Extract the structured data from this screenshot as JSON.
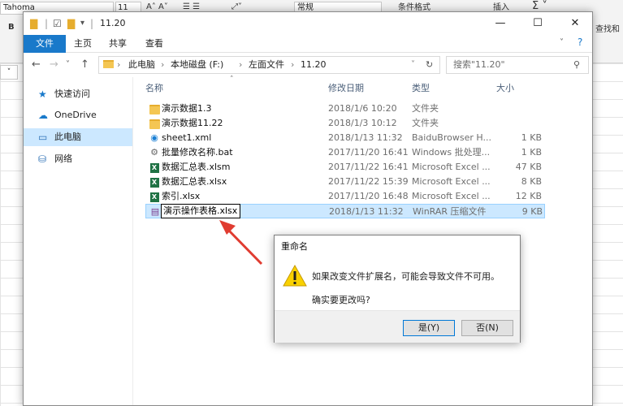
{
  "excel": {
    "font_name": "Tahoma",
    "font_size": "11",
    "format": "常规",
    "conditional_format": "条件格式",
    "insert": "插入",
    "find": "查找和",
    "col_tag": "B"
  },
  "titlebar": {
    "folder_title": "11.20",
    "minimize": "—",
    "maximize": "☐",
    "close": "✕"
  },
  "ribbon_tabs": [
    "文件",
    "主页",
    "共享",
    "查看"
  ],
  "address": {
    "crumbs": [
      "此电脑",
      "本地磁盘 (F:)",
      "左面文件",
      "11.20"
    ],
    "search_placeholder": "搜索\"11.20\""
  },
  "nav": {
    "items": [
      {
        "label": "快速访问",
        "icon": "star-icon"
      },
      {
        "label": "OneDrive",
        "icon": "cloud-icon"
      },
      {
        "label": "此电脑",
        "icon": "computer-icon",
        "selected": true
      },
      {
        "label": "网络",
        "icon": "network-icon"
      }
    ]
  },
  "columns": {
    "name": "名称",
    "date": "修改日期",
    "type": "类型",
    "size": "大小"
  },
  "files": [
    {
      "name": "演示数据1.3",
      "date": "2018/1/6 10:20",
      "type": "文件夹",
      "size": "",
      "icon": "folder-icon"
    },
    {
      "name": "演示数据11.22",
      "date": "2018/1/3 10:12",
      "type": "文件夹",
      "size": "",
      "icon": "folder-icon"
    },
    {
      "name": "sheet1.xml",
      "date": "2018/1/13 11:32",
      "type": "BaiduBrowser H...",
      "size": "1 KB",
      "icon": "xml-icon"
    },
    {
      "name": "批量修改名称.bat",
      "date": "2017/11/20 16:41",
      "type": "Windows 批处理...",
      "size": "1 KB",
      "icon": "bat-icon"
    },
    {
      "name": "数据汇总表.xlsm",
      "date": "2017/11/22 16:41",
      "type": "Microsoft Excel ...",
      "size": "47 KB",
      "icon": "excel-icon"
    },
    {
      "name": "数据汇总表.xlsx",
      "date": "2017/11/22 15:39",
      "type": "Microsoft Excel ...",
      "size": "8 KB",
      "icon": "excel-icon"
    },
    {
      "name": "索引.xlsx",
      "date": "2017/11/20 16:48",
      "type": "Microsoft Excel ...",
      "size": "12 KB",
      "icon": "excel-icon"
    },
    {
      "name": "演示操作表格.xlsx",
      "date": "2018/1/13 11:32",
      "type": "WinRAR 压缩文件",
      "size": "9 KB",
      "icon": "winrar-icon",
      "selected": true,
      "renaming": true
    }
  ],
  "dialog": {
    "title": "重命名",
    "message": "如果改变文件扩展名，可能会导致文件不可用。",
    "question": "确实要更改吗?",
    "yes": "是(Y)",
    "no": "否(N)"
  },
  "colors": {
    "accent": "#1979ca",
    "selection": "#cce8ff",
    "arrow": "#e03c31"
  }
}
